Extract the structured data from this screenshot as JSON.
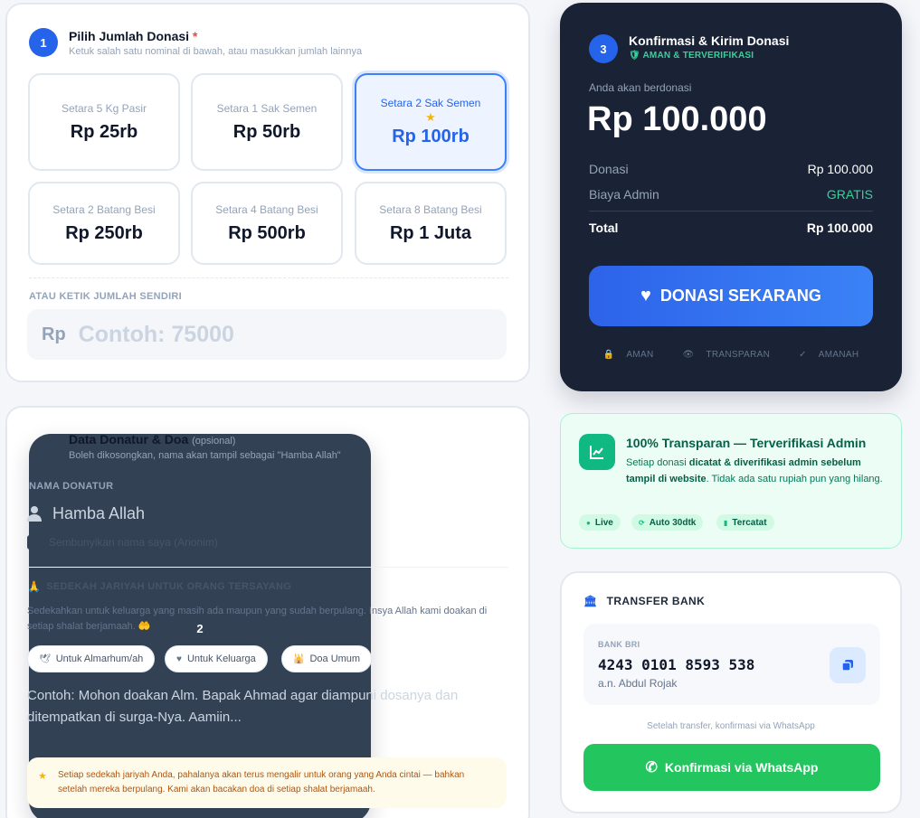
{
  "step1": {
    "number": "1",
    "title": "Pilih Jumlah Donasi",
    "required_mark": "*",
    "subtitle": "Ketuk salah satu nominal di bawah, atau masukkan jumlah lainnya",
    "amounts": [
      {
        "label": "Setara 5 Kg Pasir",
        "value": "Rp 25rb"
      },
      {
        "label": "Setara 1 Sak Semen",
        "value": "Rp 50rb"
      },
      {
        "label": "Setara 2 Sak Semen",
        "value": "Rp 100rb",
        "selected": true
      },
      {
        "label": "Setara 2 Batang Besi",
        "value": "Rp 250rb"
      },
      {
        "label": "Setara 4 Batang Besi",
        "value": "Rp 500rb"
      },
      {
        "label": "Setara 8 Batang Besi",
        "value": "Rp 1 Juta"
      }
    ],
    "custom_label": "ATAU KETIK JUMLAH SENDIRI",
    "custom_prefix": "Rp",
    "custom_placeholder": "Contoh: 75000",
    "custom_value": ""
  },
  "step2": {
    "number": "2",
    "title": "Data Donatur & Doa",
    "optional": "(opsional)",
    "subtitle": "Boleh dikosongkan, nama akan tampil sebagai \"Hamba Allah\"",
    "name_label": "NAMA DONATUR",
    "name_placeholder": "Hamba Allah",
    "name_value": "",
    "anon_label": "Sembunyikan nama saya (Anonim)",
    "anon_checked": false,
    "jariyah_title": "SEDEKAH JARIYAH UNTUK ORANG TERSAYANG",
    "jariyah_desc": "Sedekahkan untuk keluarga yang masih ada maupun yang sudah berpulang. Insya Allah kami doakan di setiap shalat berjamaah. 🤲",
    "chips": [
      {
        "label": "Untuk Almarhum/ah",
        "icon": "dove-icon"
      },
      {
        "label": "Untuk Keluarga",
        "icon": "heart-icon"
      },
      {
        "label": "Doa Umum",
        "icon": "mosque-icon"
      }
    ],
    "prayer_placeholder": "Contoh: Mohon doakan Alm. Bapak Ahmad agar diampuni dosanya dan ditempatkan di surga-Nya. Aamiin...",
    "prayer_value": "",
    "note": "Setiap sedekah jariyah Anda, pahalanya akan terus mengalir untuk orang yang Anda cintai — bahkan setelah mereka berpulang. Kami akan bacakan doa di setiap shalat berjamaah."
  },
  "step3": {
    "number": "3",
    "title": "Konfirmasi & Kirim Donasi",
    "verified": "AMAN & TERVERIFIKASI",
    "you_donate": "Anda akan berdonasi",
    "amount": "Rp 100.000",
    "rows": [
      {
        "key": "Donasi",
        "value": "Rp 100.000"
      },
      {
        "key": "Biaya Admin",
        "value": "GRATIS"
      }
    ],
    "total_key": "Total",
    "total_value": "Rp 100.000",
    "cta": "DONASI SEKARANG",
    "trust": [
      "AMAN",
      "TRANSPARAN",
      "AMANAH"
    ]
  },
  "transparency": {
    "title": "100% Transparan — Terverifikasi Admin",
    "desc_pre": "Setiap donasi ",
    "desc_bold": "dicatat & diverifikasi admin sebelum tampil di website",
    "desc_post": ". Tidak ada satu rupiah pun yang hilang.",
    "badges": [
      "Live",
      "Auto 30dtk",
      "Tercatat"
    ]
  },
  "bank": {
    "title": "TRANSFER BANK",
    "bank_name": "BANK BRI",
    "account_number": "4243 0101 8593 538",
    "account_name": "a.n. Abdul Rojak",
    "hint": "Setelah transfer, konfirmasi via WhatsApp",
    "wa_button": "Konfirmasi via WhatsApp"
  },
  "colors": {
    "primary": "#2563eb",
    "dark_card": "#1a2235",
    "success": "#10b981",
    "whatsapp": "#22c55e",
    "warning_bg": "#fffbeb"
  }
}
